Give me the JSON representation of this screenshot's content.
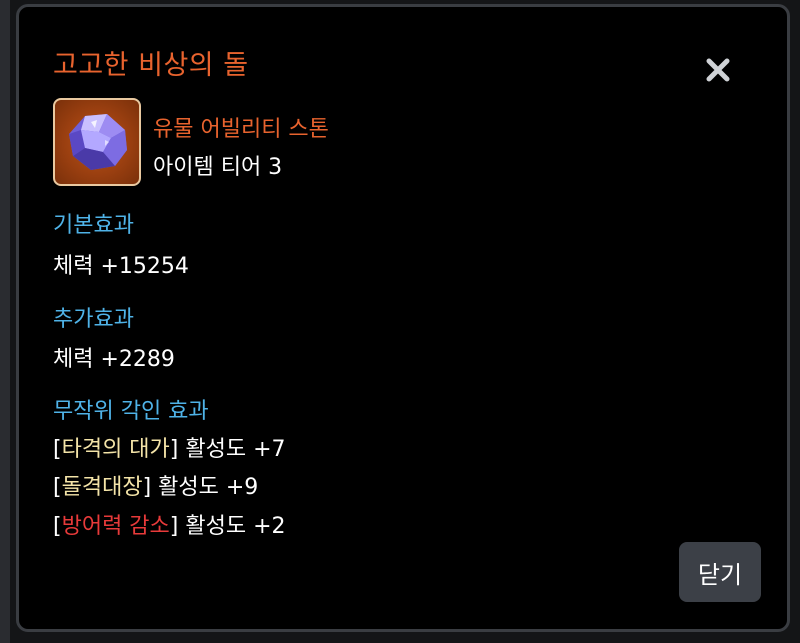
{
  "dialog": {
    "title": "고고한 비상의 돌",
    "close_button_label": "닫기"
  },
  "item": {
    "icon": "crystal-stone-icon",
    "name": "유물 어빌리티 스톤",
    "tier": "아이템 티어 3"
  },
  "sections": {
    "basic": {
      "heading": "기본효과",
      "value": "체력 +15254"
    },
    "bonus": {
      "heading": "추가효과",
      "value": "체력 +2289"
    },
    "engravings": {
      "heading": "무작위 각인 효과",
      "rows": [
        {
          "open": "[",
          "name": "타격의 대가",
          "close": "]",
          "value": " 활성도 +7",
          "color": "#f4e4a8"
        },
        {
          "open": "[",
          "name": "돌격대장",
          "close": "]",
          "value": " 활성도 +9",
          "color": "#f4e4a8"
        },
        {
          "open": "[",
          "name": "방어력 감소",
          "close": "]",
          "value": " 활성도 +2",
          "color": "#e83a3a"
        }
      ]
    }
  },
  "colors": {
    "title": "#e8632e",
    "section_heading": "#4fb3e8",
    "positive_engraving": "#f4e4a8",
    "negative_engraving": "#e83a3a",
    "button_bg": "#3c4047"
  }
}
